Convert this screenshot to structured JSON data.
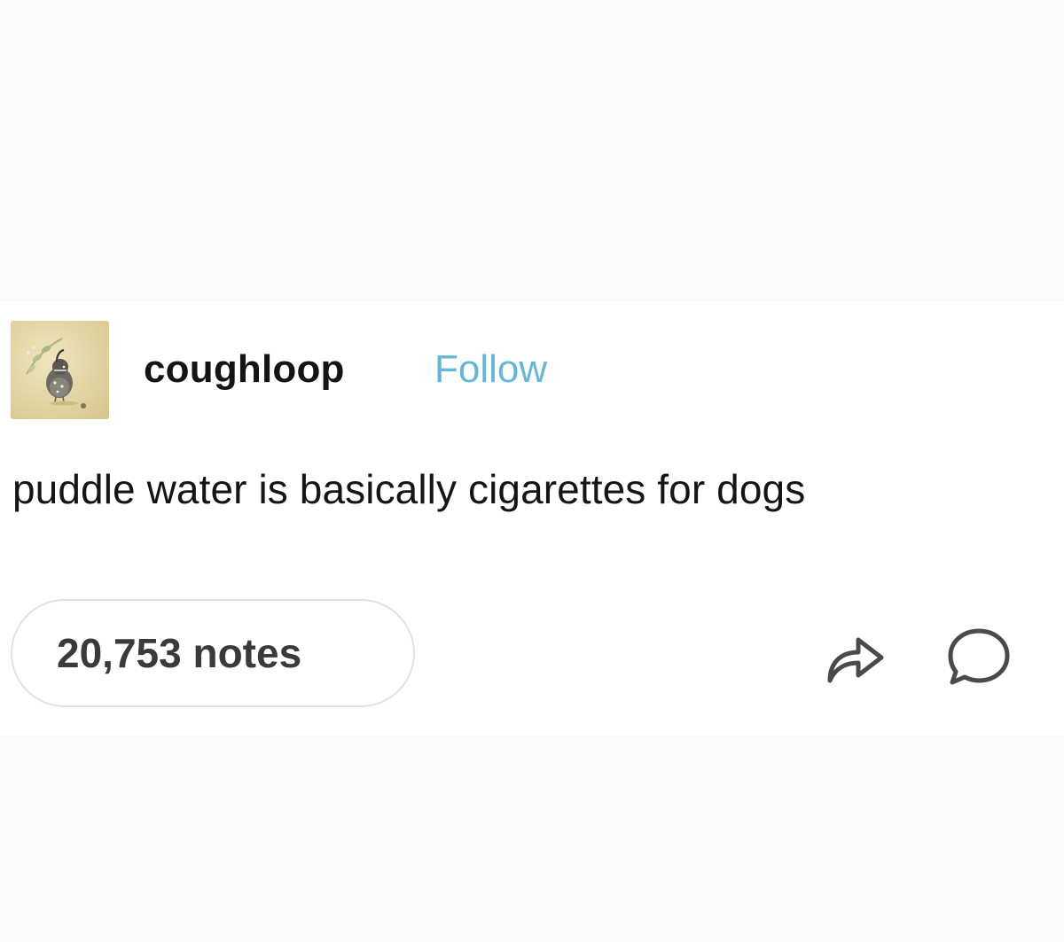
{
  "post": {
    "author": {
      "avatar_icon": "quail-avatar-icon",
      "username": "coughloop",
      "follow_label": "Follow",
      "follow_color": "#66b6d6"
    },
    "body_text": "puddle water is basically cigarettes for dogs",
    "footer": {
      "notes_label": "20,753 notes",
      "share_icon": "share-arrow-icon",
      "reply_icon": "reply-bubble-icon"
    }
  }
}
